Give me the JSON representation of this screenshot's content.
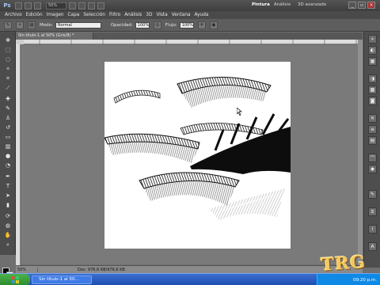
{
  "app": {
    "logo": "Ps",
    "zoom": "50%",
    "workspaces": [
      "Pintura",
      "Análisis",
      "3D avanzado"
    ],
    "win_controls": [
      "_",
      "▫",
      "×"
    ]
  },
  "menu": [
    "Archivo",
    "Edición",
    "Imagen",
    "Capa",
    "Selección",
    "Filtro",
    "Análisis",
    "3D",
    "Vista",
    "Ventana",
    "Ayuda"
  ],
  "options": {
    "mode_label": "Modo:",
    "mode_value": "Normal",
    "opacity_label": "Opacidad:",
    "opacity_value": "100%",
    "flow_label": "Flujo:",
    "flow_value": "100%"
  },
  "document": {
    "tab_label": "Sin título-1 al 50% (Gris/8) *"
  },
  "status": {
    "zoom": "50%",
    "doc": "Doc: 976,6 KB/976,6 KB"
  },
  "taskbar": {
    "start": "",
    "item": "Sin título-1 al 50...",
    "clock": "09:20 p.m."
  },
  "watermark": "TRG",
  "colors": {
    "foreground": "#000000",
    "background": "#ffffff",
    "accent": "#f4c85a"
  },
  "icons": {
    "tools": [
      "move-icon",
      "marquee-icon",
      "lasso-icon",
      "quick-select-icon",
      "crop-icon",
      "eyedropper-icon",
      "healing-icon",
      "brush-icon",
      "stamp-icon",
      "history-brush-icon",
      "eraser-icon",
      "gradient-icon",
      "blur-icon",
      "dodge-icon",
      "pen-icon",
      "type-icon",
      "path-select-icon",
      "shape-icon",
      "3d-rotate-icon",
      "3d-orbit-icon",
      "hand-icon",
      "zoom-icon"
    ],
    "dock": [
      "arrange-icon",
      "color-icon",
      "swatches-icon",
      "adjustments-icon",
      "styles-icon",
      "masks-icon",
      "tools-icon",
      "layers-icon",
      "channels-icon",
      "paths-icon",
      "3d-icon",
      "brushes-icon"
    ]
  }
}
